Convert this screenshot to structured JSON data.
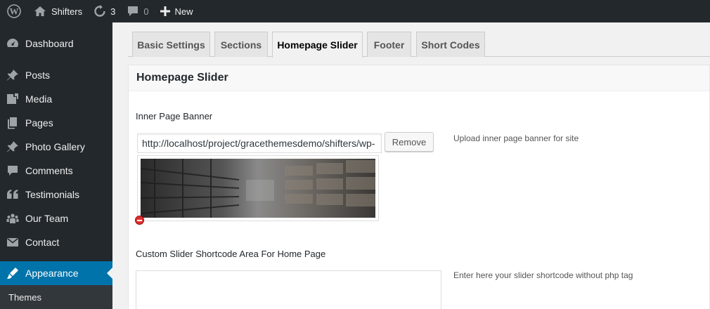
{
  "adminbar": {
    "site_name": "Shifters",
    "updates_count": "3",
    "comments_count": "0",
    "new_label": "New"
  },
  "sidebar": {
    "items": [
      {
        "label": "Dashboard",
        "icon": "dashboard-icon"
      },
      {
        "label": "Posts",
        "icon": "pin-icon"
      },
      {
        "label": "Media",
        "icon": "media-icon"
      },
      {
        "label": "Pages",
        "icon": "pages-icon"
      },
      {
        "label": "Photo Gallery",
        "icon": "pin-icon"
      },
      {
        "label": "Comments",
        "icon": "comment-icon"
      },
      {
        "label": "Testimonials",
        "icon": "quote-icon"
      },
      {
        "label": "Our Team",
        "icon": "groups-icon"
      },
      {
        "label": "Contact",
        "icon": "email-icon"
      },
      {
        "label": "Appearance",
        "icon": "brush-icon",
        "active": true
      }
    ],
    "submenu": [
      "Themes"
    ]
  },
  "tabs": [
    {
      "label": "Basic Settings"
    },
    {
      "label": "Sections"
    },
    {
      "label": "Homepage Slider",
      "active": true
    },
    {
      "label": "Footer"
    },
    {
      "label": "Short Codes"
    }
  ],
  "panel": {
    "title": "Homepage Slider",
    "banner": {
      "label": "Inner Page Banner",
      "url_value": "http://localhost/project/gracethemesdemo/shifters/wp-",
      "remove_label": "Remove",
      "help": "Upload inner page banner for site"
    },
    "shortcode": {
      "label": "Custom Slider Shortcode Area For Home Page",
      "help": "Enter here your slider shortcode without php tag",
      "value": ""
    }
  },
  "colors": {
    "adminbar_bg": "#23282d",
    "active_menu": "#0073aa",
    "remove_red": "#dc3232"
  }
}
